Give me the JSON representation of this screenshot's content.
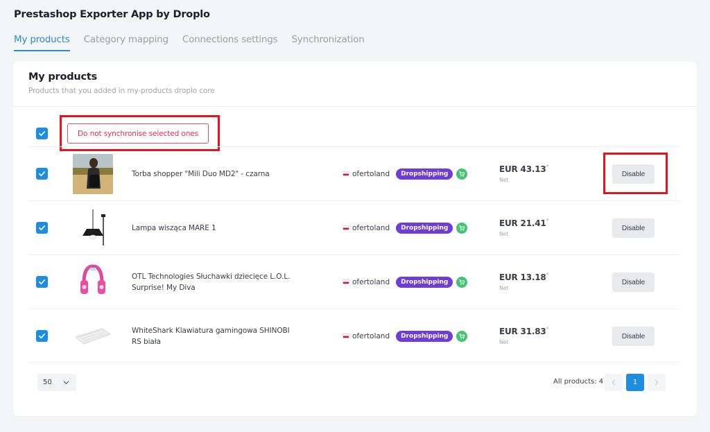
{
  "app": {
    "title": "Prestashop Exporter App by Droplo"
  },
  "tabs": [
    {
      "label": "My products",
      "active": true
    },
    {
      "label": "Category mapping",
      "active": false
    },
    {
      "label": "Connections settings",
      "active": false
    },
    {
      "label": "Synchronization",
      "active": false
    }
  ],
  "card": {
    "title": "My products",
    "subtitle": "Products that you added in my-products droplo core"
  },
  "bulk": {
    "select_all_checked": true,
    "sync_button_label": "Do not synchronise selected ones"
  },
  "products": [
    {
      "name": "Torba shopper \"Mili Duo MD2\" - czarna",
      "vendor": "ofertoland",
      "badge": "Dropshipping",
      "price": "EUR 43.13",
      "price_mark": "*",
      "net": "Net",
      "action": "Disable",
      "checked": true
    },
    {
      "name": "Lampa wisząca MARE 1",
      "vendor": "ofertoland",
      "badge": "Dropshipping",
      "price": "EUR 21.41",
      "price_mark": "*",
      "net": "Net",
      "action": "Disable",
      "checked": true
    },
    {
      "name": "OTL Technologies Słuchawki dziecięce L.O.L. Surprise! My Diva",
      "vendor": "ofertoland",
      "badge": "Dropshipping",
      "price": "EUR 13.18",
      "price_mark": "*",
      "net": "Net",
      "action": "Disable",
      "checked": true
    },
    {
      "name": "WhiteShark Klawiatura gamingowa SHINOBI RS biała",
      "vendor": "ofertoland",
      "badge": "Dropshipping",
      "price": "EUR 31.83",
      "price_mark": "*",
      "net": "Net",
      "action": "Disable",
      "checked": true
    }
  ],
  "footer": {
    "per_page": "50",
    "all_products": "All products: 4",
    "current_page": "1"
  },
  "colors": {
    "accent": "#1e8de0",
    "danger": "#e03050",
    "badge": "#6f3bd9",
    "cart": "#44c472",
    "annotation": "#e0161e"
  },
  "icons": {
    "checkbox": "check-icon",
    "cart": "shopping-cart-icon",
    "flag": "poland-flag-icon",
    "dropdown": "chevron-down-icon",
    "prev": "chevron-left-icon",
    "next": "chevron-right-icon"
  }
}
